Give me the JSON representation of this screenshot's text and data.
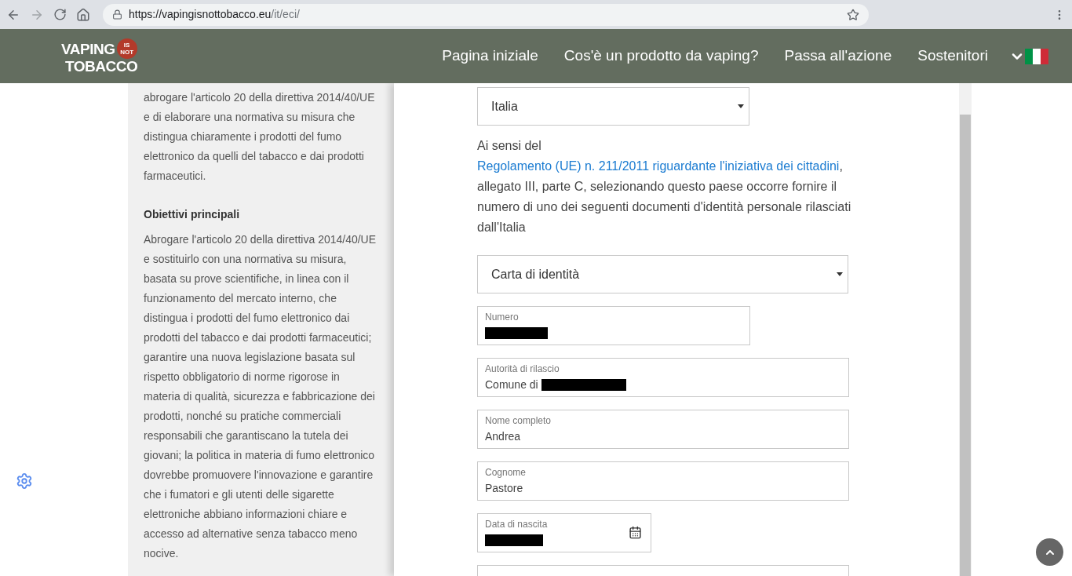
{
  "browser": {
    "url_host": "https://vapingisnottobacco.eu",
    "url_path": "/it/eci/"
  },
  "logo": {
    "word_top": "VAPING",
    "badge_top": "IS",
    "badge_bottom": "NOT",
    "word_bottom": "TOBACCO"
  },
  "nav": {
    "items": [
      "Pagina iniziale",
      "Cos'è un prodotto da vaping?",
      "Passa all'azione",
      "Sostenitori"
    ]
  },
  "sidebar": {
    "intro": "abrogare l'articolo 20 della direttiva 2014/40/UE e di elaborare una normativa su misura che distingua chiaramente i prodotti del fumo elettronico da quelli del tabacco e dai prodotti farmaceutici.",
    "heading": "Obiettivi principali",
    "body": "Abrogare l'articolo 20 della direttiva 2014/40/UE e sostituirlo con una normativa su misura, basata su prove scientifiche, in linea con il funzionamento del mercato interno, che distingua i prodotti del fumo elettronico dai prodotti del tabacco e dai prodotti farmaceutici; garantire una nuova legislazione basata sul rispetto obbligatorio di norme rigorose in materia di qualità, sicurezza e fabbricazione dei prodotti, nonché su pratiche commerciali responsabili che garantiscano la tutela dei giovani; la politica in materia di fumo elettronico dovrebbe promuovere l'innovazione e garantire che i fumatori e gli utenti delle sigarette elettroniche abbiano informazioni chiare e accesso ad alternative senza tabacco meno nocive."
  },
  "form": {
    "country": "Italia",
    "notice": {
      "before": "Ai sensi del",
      "link": "Regolamento (UE) n. 211/2011 riguardante l'iniziativa dei cittadini",
      "after": ", allegato III, parte C, selezionando questo paese occorre fornire il numero di uno dei seguenti documenti d'identità personale rilasciati dall'Italia"
    },
    "document_type": "Carta di identità",
    "fields": [
      {
        "kind": "text",
        "label": "Numero",
        "redacted": true
      },
      {
        "kind": "text",
        "label": "Autorità di rilascio",
        "value": "Comune di",
        "redacted": true
      },
      {
        "kind": "text",
        "label": "Nome completo",
        "value": "Andrea",
        "redacted": false
      },
      {
        "kind": "text",
        "label": "Cognome",
        "value": "Pastore",
        "redacted": false
      },
      {
        "kind": "date",
        "label": "Data di nascita",
        "redacted": true
      }
    ]
  }
}
